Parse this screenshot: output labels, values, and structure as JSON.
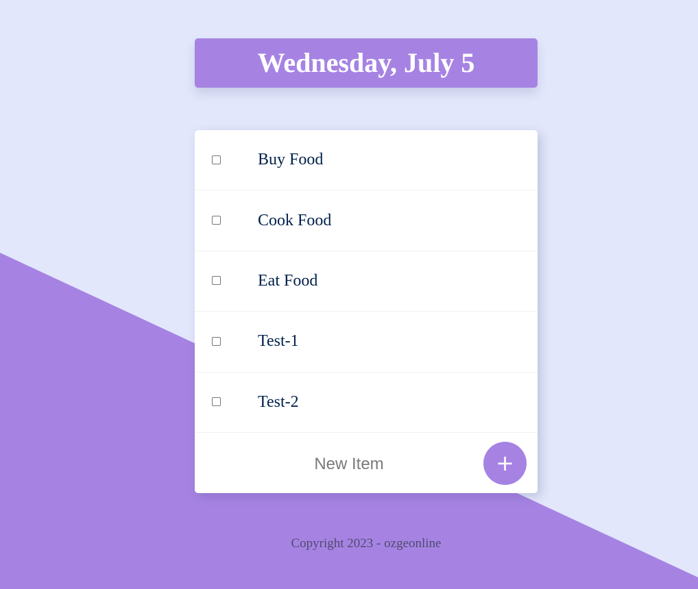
{
  "heading": {
    "date": "Wednesday, July 5"
  },
  "todo": {
    "items": [
      {
        "label": "Buy Food",
        "checked": false
      },
      {
        "label": "Cook Food",
        "checked": false
      },
      {
        "label": "Eat Food",
        "checked": false
      },
      {
        "label": "Test-1",
        "checked": false
      },
      {
        "label": "Test-2",
        "checked": false
      }
    ],
    "new_item_placeholder": "New Item",
    "add_button_label": "+"
  },
  "footer": {
    "copyright": "Copyright 2023 - ozgeonline"
  },
  "colors": {
    "accent": "#a683e3",
    "background": "#e2e7fb",
    "item_text": "#00204a"
  }
}
